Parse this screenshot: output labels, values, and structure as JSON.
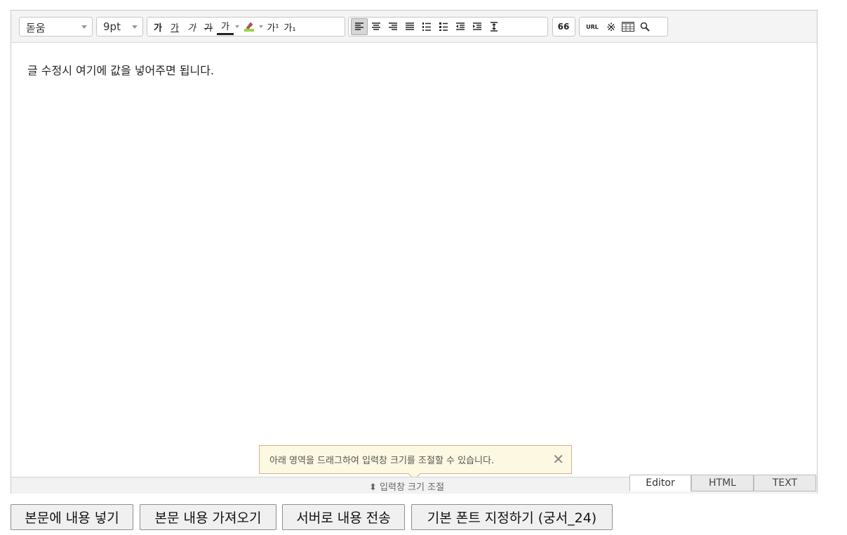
{
  "toolbar": {
    "font_family": "돋움",
    "font_size": "9pt",
    "format_buttons": {
      "bold": "가",
      "underline": "가",
      "italic": "가",
      "strike": "가",
      "font_color": "가",
      "superscript": "가¹",
      "subscript": "가₁"
    },
    "url_button": "URL",
    "quote_button": "66",
    "special_char_button": "※"
  },
  "editor": {
    "content": "글 수정시 여기에 값을 넣어주면 됩니다."
  },
  "tooltip": {
    "text": "아래 영역을 드래그하여 입력창 크기를 조절할 수 있습니다."
  },
  "resize_bar": {
    "label": "입력창 크기 조절"
  },
  "mode_tabs": [
    {
      "label": "Editor",
      "active": true
    },
    {
      "label": "HTML",
      "active": false
    },
    {
      "label": "TEXT",
      "active": false
    }
  ],
  "buttons": {
    "insert_content": "본문에 내용 넣기",
    "get_content": "본문 내용 가져오기",
    "send_to_server": "서버로 내용 전송",
    "set_default_font": "기본 폰트 지정하기 (궁서_24)"
  },
  "colors": {
    "toolbar_bg": "#f4f4f4",
    "tooltip_bg": "#fdf8e2",
    "border": "#c9c9c9"
  }
}
